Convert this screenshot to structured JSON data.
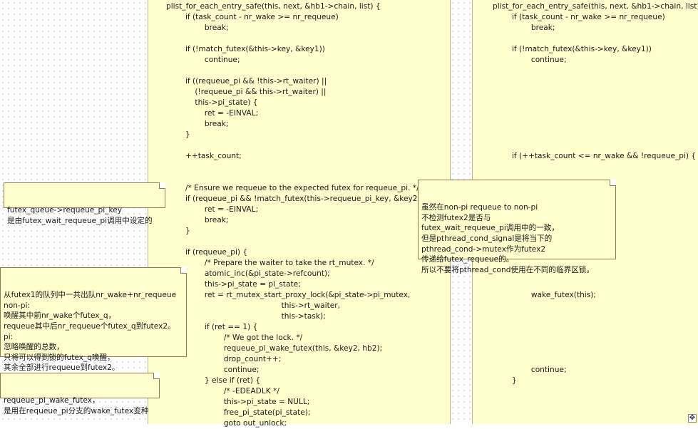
{
  "left_code": [
    "plist_for_each_entry_safe(this, next, &hb1->chain, list) {",
    "        if (task_count - nr_wake >= nr_requeue)",
    "                break;",
    "",
    "        if (!match_futex(&this->key, &key1))",
    "                continue;",
    "",
    "        if ((requeue_pi && !this->rt_waiter) ||",
    "            (!requeue_pi && this->rt_waiter) ||",
    "            this->pi_state) {",
    "                ret = -EINVAL;",
    "                break;",
    "        }",
    "",
    "        ++task_count;",
    "",
    "",
    "        /* Ensure we requeue to the expected futex for requeue_pi. */",
    "        if (requeue_pi && !match_futex(this->requeue_pi_key, &key2)) {",
    "                ret = -EINVAL;",
    "                break;",
    "        }",
    "",
    "        if (requeue_pi) {",
    "                /* Prepare the waiter to take the rt_mutex. */",
    "                atomic_inc(&pi_state->refcount);",
    "                this->pi_state = pi_state;",
    "                ret = rt_mutex_start_proxy_lock(&pi_state->pi_mutex,",
    "                                                this->rt_waiter,",
    "                                                this->task);",
    "                if (ret == 1) {",
    "                        /* We got the lock. */",
    "                        requeue_pi_wake_futex(this, &key2, hb2);",
    "                        drop_count++;",
    "                        continue;",
    "                } else if (ret) {",
    "                        /* -EDEADLK */",
    "                        this->pi_state = NULL;",
    "                        free_pi_state(pi_state);",
    "                        goto out_unlock;"
  ],
  "right_code": [
    "plist_for_each_entry_safe(this, next, &hb1->chain, list) {",
    "        if (task_count - nr_wake >= nr_requeue)",
    "                break;",
    "",
    "        if (!match_futex(&this->key, &key1))",
    "                continue;",
    "",
    "",
    "",
    "",
    "",
    "",
    "",
    "",
    "        if (++task_count <= nr_wake && !requeue_pi) {",
    "",
    "",
    "",
    "",
    "",
    "",
    "",
    "",
    "",
    "",
    "",
    "",
    "                wake_futex(this);",
    "",
    "",
    "",
    "",
    "",
    "",
    "                continue;",
    "        }"
  ],
  "notes": {
    "requeue_pi_key": [
      "futex_queue->requeue_pi_key",
      "是由futex_wait_requeue_pi调用中设定的"
    ],
    "dequeue_count": [
      "从futex1的队列中一共出队nr_wake+nr_requeue",
      "non-pi:",
      "唤醒其中前nr_wake个futex_q，",
      "requeue其中后nr_requeue个futex_q到futex2。",
      "pi:",
      "忽略唤醒的总数，",
      "只将可以得到锁的futex_q唤醒，",
      "其余全部进行requeue到futex2。"
    ],
    "requeue_pi_wake_futex": [
      "requeue_pi_wake_futex，",
      "是用在requeue_pi分支的wake_futex变种"
    ],
    "non_pi_requeue": [
      "虽然在non-pi requeue to non-pi",
      "不检测futex2是否与",
      "futex_wait_requeue_pi调用中的一致，",
      "但是pthread_cond_signal是将当下的",
      "pthread_cond->mutex作为futex2",
      "传递给futex_requeue的。",
      "所以不要将pthread_cond使用在不同的临界区锁。"
    ]
  },
  "resize_icon": "move-resize-icon"
}
